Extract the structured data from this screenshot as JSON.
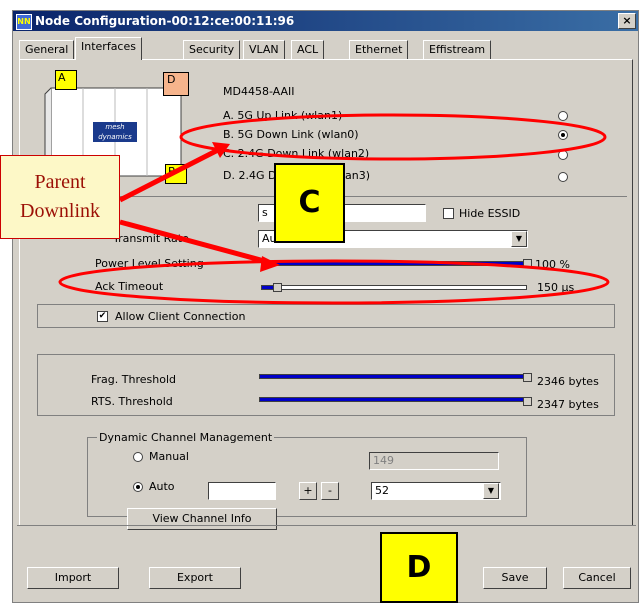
{
  "window": {
    "title": "Node Configuration-00:12:ce:00:11:96",
    "close_glyph": "×"
  },
  "tabs": [
    {
      "label": "General"
    },
    {
      "label": "Interfaces"
    },
    {
      "label": "Security"
    },
    {
      "label": "VLAN"
    },
    {
      "label": "ACL"
    },
    {
      "label": "Ethernet"
    },
    {
      "label": "Effistream"
    }
  ],
  "device": {
    "model": "MD4458-AAII",
    "port_labels": [
      "A",
      "D",
      "B"
    ],
    "logo": "mesh dynamics",
    "port_colors": {
      "A": "#ffff00",
      "D": "#f6b48c",
      "B": "#ffff00"
    }
  },
  "interfaces": [
    {
      "label": "A. 5G  Up Link (wlan1)",
      "selected": false
    },
    {
      "label": "B. 5G  Down Link (wlan0)",
      "selected": true
    },
    {
      "label": "C. 2.4G  Down Link (wlan2)",
      "selected": false
    },
    {
      "label": "D. 2.4G  Down Link (wlan3)",
      "selected": false
    }
  ],
  "settings": {
    "essid_value": "s",
    "hide_essid_label": "Hide ESSID",
    "transmit_rate_label": "Transmit Rate",
    "transmit_rate_value": "Auto",
    "power_level_label": "Power Level Setting",
    "power_level_value": "100 %",
    "power_level_fraction": 1.0,
    "ack_timeout_label": "Ack Timeout",
    "ack_timeout_value": "150 µs",
    "ack_timeout_fraction": 0.06,
    "allow_client_label": "Allow Client Connection",
    "allow_client_checked": true,
    "frag_label": "Frag. Threshold",
    "frag_value": "2346 bytes",
    "rts_label": "RTS. Threshold",
    "rts_value": "2347 bytes"
  },
  "dcm": {
    "group_label": "Dynamic Channel Management",
    "manual_label": "Manual",
    "manual_channel": "149",
    "auto_label": "Auto",
    "auto_selected": true,
    "auto_field": "",
    "plus": "+",
    "minus": "-",
    "auto_channel": "52",
    "view_button": "View Channel Info"
  },
  "footer": {
    "import": "Import",
    "export": "Export",
    "save": "Save",
    "cancel": "Cancel"
  },
  "annotations": {
    "callout_line1": "Parent",
    "callout_line2": "Downlink",
    "box_c": "C",
    "box_d": "D",
    "annotation_color": "#ff0000"
  },
  "icons": {
    "app": "app-icon",
    "dropdown": "▼",
    "check": "✔"
  }
}
